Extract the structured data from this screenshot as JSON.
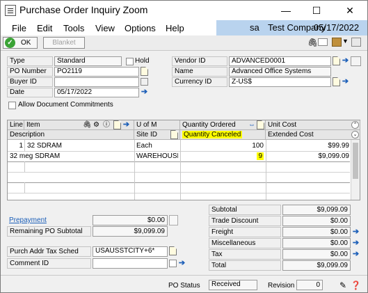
{
  "window": {
    "title": "Purchase Order Inquiry Zoom",
    "minimize": "—",
    "maximize": "☐",
    "close": "✕"
  },
  "menu": {
    "items": [
      "File",
      "Edit",
      "Tools",
      "View",
      "Options",
      "Help"
    ],
    "user": "sa",
    "company": "Test Company",
    "date": "05/17/2022"
  },
  "toolbar": {
    "ok_label": "OK",
    "blanket_label": "Blanket"
  },
  "header": {
    "type_label": "Type",
    "type_value": "Standard",
    "hold_label": "Hold",
    "po_number_label": "PO Number",
    "po_number_value": "PO2119",
    "buyer_id_label": "Buyer ID",
    "buyer_id_value": "",
    "date_label": "Date",
    "date_value": "05/17/2022",
    "allow_commitments_label": "Allow Document Commitments",
    "vendor_id_label": "Vendor ID",
    "vendor_id_value": "ADVANCED0001",
    "name_label": "Name",
    "name_value": "Advanced Office Systems",
    "currency_id_label": "Currency ID",
    "currency_id_value": "Z-US$"
  },
  "grid": {
    "headers_row1": {
      "line": "Line",
      "item": "Item",
      "uom": "U of M",
      "qty_ordered": "Quantity Ordered",
      "unit_cost": "Unit Cost"
    },
    "headers_row2": {
      "description": "Description",
      "site_id": "Site ID",
      "qty_canceled": "Quantity Canceled",
      "extended_cost": "Extended Cost"
    },
    "rows": [
      {
        "line": "1",
        "item": "32 SDRAM",
        "uom": "Each",
        "qty_ordered": "100",
        "unit_cost": "$99.99"
      },
      {
        "description": "32 meg SDRAM",
        "site_id": "WAREHOUSE",
        "qty_canceled": "9",
        "extended_cost": "$9,099.09"
      }
    ]
  },
  "left_summary": {
    "prepayment_label": "Prepayment",
    "prepayment_value": "$0.00",
    "remaining_label": "Remaining PO Subtotal",
    "remaining_value": "$9,099.09",
    "tax_sched_label": "Purch Addr Tax Sched",
    "tax_sched_value": "USAUSSTCITY+6*",
    "comment_id_label": "Comment ID",
    "comment_id_value": ""
  },
  "totals": [
    {
      "label": "Subtotal",
      "value": "$9,099.09"
    },
    {
      "label": "Trade Discount",
      "value": "$0.00"
    },
    {
      "label": "Freight",
      "value": "$0.00"
    },
    {
      "label": "Miscellaneous",
      "value": "$0.00"
    },
    {
      "label": "Tax",
      "value": "$0.00"
    },
    {
      "label": "Total",
      "value": "$9,099.09"
    }
  ],
  "footer": {
    "po_status_label": "PO Status",
    "po_status_value": "Received",
    "revision_label": "Revision",
    "revision_value": "0"
  },
  "colors": {
    "highlight": "#ffff00",
    "link": "#1c5fb8",
    "company_bar": "#b9d3ee",
    "ok_green": "#3aa335"
  }
}
